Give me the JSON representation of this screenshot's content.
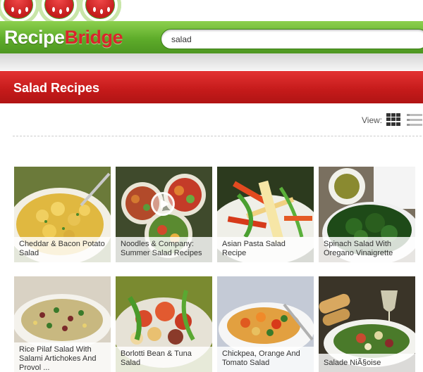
{
  "header": {
    "logo_part1": "Recipe",
    "logo_part2": "Bridge",
    "search_value": "salad"
  },
  "page": {
    "title": "Salad Recipes",
    "view_label": "View:"
  },
  "icons": {
    "grid_view": "grid-icon",
    "list_view": "list-icon",
    "play": "play-icon"
  },
  "colors": {
    "brand_green": "#5eac2a",
    "brand_red": "#c41a1a"
  },
  "recipes": [
    {
      "label": "Cheddar & Bacon Potato Salad"
    },
    {
      "label": "Noodles & Company: Summer Salad Recipes",
      "video": true
    },
    {
      "label": "Asian Pasta Salad Recipe"
    },
    {
      "label": "Spinach Salad With Oregano Vinaigrette"
    },
    {
      "label": "Rice Pilaf Salad With Salami Artichokes And Provol ..."
    },
    {
      "label": "Borlotti Bean & Tuna Salad"
    },
    {
      "label": "Chickpea, Orange And Tomato Salad"
    },
    {
      "label": "Salade NiÃ§oise"
    }
  ]
}
